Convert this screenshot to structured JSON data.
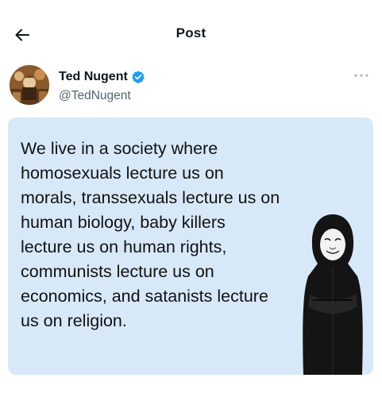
{
  "header": {
    "title": "Post",
    "back_icon": "arrow-left-icon"
  },
  "author": {
    "display_name": "Ted Nugent",
    "handle": "@TedNugent",
    "verified": true,
    "verified_color": "#1d9bf0",
    "avatar_icon": "avatar-photo",
    "more_icon": "more-dots-icon"
  },
  "post": {
    "text": "We live in a society where\nhomosexuals lecture us on\nmorals, transsexuals lecture us on\nhuman biology, baby killers\nlecture us on human rights,\ncommunists lecture us on\neconomics, and satanists lecture\nus on religion.",
    "background_color": "#d7e9f9",
    "image_icon": "hooded-figure-image"
  }
}
